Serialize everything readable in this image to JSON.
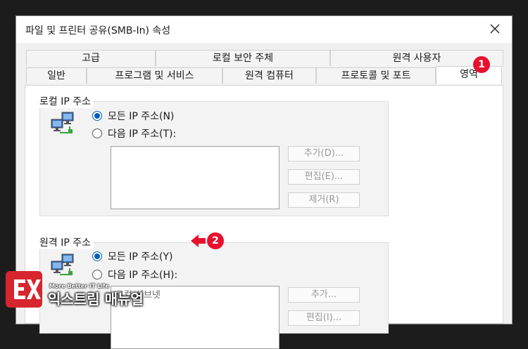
{
  "window": {
    "title": "파일 및 프린터 공유(SMB-In) 속성"
  },
  "tabs_top": [
    "고급",
    "로컬 보안 주체",
    "원격 사용자"
  ],
  "tabs_bottom": [
    "일반",
    "프로그램 및 서비스",
    "원격 컴퓨터",
    "프로토콜 및 포트",
    "영역"
  ],
  "active_tab": "영역",
  "local_ip": {
    "legend": "로컬 IP 주소",
    "option_any": "모든 IP 주소(N)",
    "option_these": "다음 IP 주소(T):",
    "selected": "any",
    "buttons": {
      "add": "추가(D)...",
      "edit": "편집(E)...",
      "remove": "제거(R)"
    }
  },
  "remote_ip": {
    "legend": "원격 IP 주소",
    "option_any": "모든 IP 주소(Y)",
    "option_these": "다음 IP 주소(H):",
    "selected": "any",
    "list_item": "로컬 서브넷",
    "buttons": {
      "add": "추가...",
      "edit": "편집(I)..."
    }
  },
  "annotations": {
    "badge1": "1",
    "badge2": "2",
    "badge_color": "#e8112d"
  },
  "watermark": {
    "logo_glyph": "EX",
    "tagline": "More Better IT Life",
    "name": "익스트림 매뉴얼",
    "logo_color": "#d6252e"
  },
  "colors": {
    "accent": "#005fb8",
    "background": "#1c1c1c",
    "dialog": "#f0f0f0"
  }
}
